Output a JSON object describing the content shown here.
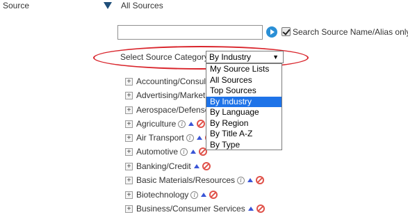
{
  "source_row": {
    "label": "Source",
    "value": "All Sources"
  },
  "search": {
    "value": "",
    "alias_only_label": "Search Source Name/Alias only",
    "alias_only_checked": true
  },
  "category": {
    "label": "Select Source Category",
    "selected": "By Industry",
    "options": [
      "My Source Lists",
      "All Sources",
      "Top Sources",
      "By Industry",
      "By Language",
      "By Region",
      "By Title A-Z",
      "By Type"
    ]
  },
  "industries": [
    {
      "label": "Accounting/Consulting"
    },
    {
      "label": "Advertising/Marketing"
    },
    {
      "label": "Aerospace/Defense"
    },
    {
      "label": "Agriculture"
    },
    {
      "label": "Air Transport"
    },
    {
      "label": "Automotive"
    },
    {
      "label": "Banking/Credit"
    },
    {
      "label": "Basic Materials/Resources"
    },
    {
      "label": "Biotechnology"
    },
    {
      "label": "Business/Consumer Services"
    }
  ],
  "icons": {
    "expand": "plus-icon",
    "info": "info-icon",
    "include": "up-arrow-icon",
    "exclude": "block-icon",
    "go": "play-icon",
    "toggle": "triangle-down-icon"
  },
  "colors": {
    "selected_option": "#1e73e8",
    "highlight_ellipse": "#d9242b",
    "include_icon": "#3a55d6",
    "exclude_icon": "#e0524a",
    "go_button": "#2a8fd6",
    "toggle_arrow": "#1f4e79"
  }
}
